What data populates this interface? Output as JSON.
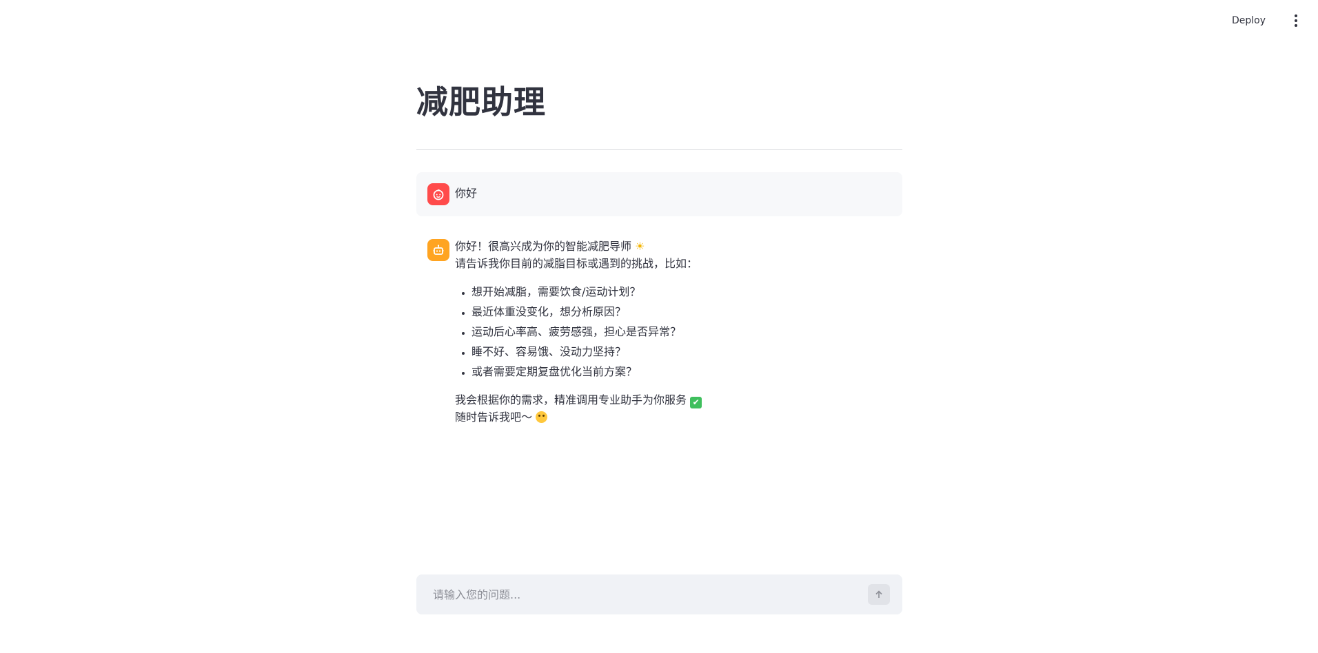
{
  "topbar": {
    "deploy_label": "Deploy"
  },
  "page": {
    "title": "减肥助理"
  },
  "messages": {
    "user": {
      "text": "你好"
    },
    "bot": {
      "line1": "你好！很高兴成为你的智能减肥导师",
      "line2": "请告诉我你目前的减脂目标或遇到的挑战，比如：",
      "items": [
        "想开始减脂，需要饮食/运动计划？",
        "最近体重没变化，想分析原因？",
        "运动后心率高、疲劳感强，担心是否异常？",
        "睡不好、容易饿、没动力坚持？",
        "或者需要定期复盘优化当前方案？"
      ],
      "closing1": "我会根据你的需求，精准调用专业助手为你服务",
      "closing2": "随时告诉我吧〜"
    }
  },
  "chat_input": {
    "placeholder": "请输入您的问题..."
  },
  "colors": {
    "user_avatar": "#ff4b4b",
    "bot_avatar": "#ffa421",
    "input_bg": "#f0f2f6",
    "text": "#31333f"
  }
}
